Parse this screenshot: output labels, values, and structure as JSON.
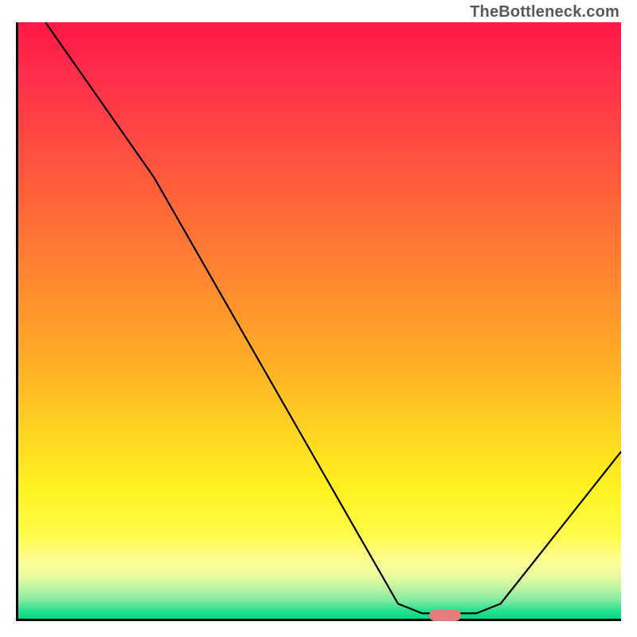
{
  "watermark": "TheBottleneck.com",
  "chart_data": {
    "type": "line",
    "title": "",
    "xlabel": "",
    "ylabel": "",
    "xlim": [
      0,
      100
    ],
    "ylim": [
      0,
      100
    ],
    "curve": [
      {
        "x": 4.5,
        "y": 100
      },
      {
        "x": 18,
        "y": 80.5
      },
      {
        "x": 22.5,
        "y": 74
      },
      {
        "x": 63,
        "y": 2.5
      },
      {
        "x": 67,
        "y": 0.9
      },
      {
        "x": 76,
        "y": 0.9
      },
      {
        "x": 80,
        "y": 2.5
      },
      {
        "x": 100,
        "y": 28
      }
    ],
    "marker": {
      "x_pct": 70.5,
      "y_pct": 99.1,
      "color": "#e77c7c"
    }
  }
}
